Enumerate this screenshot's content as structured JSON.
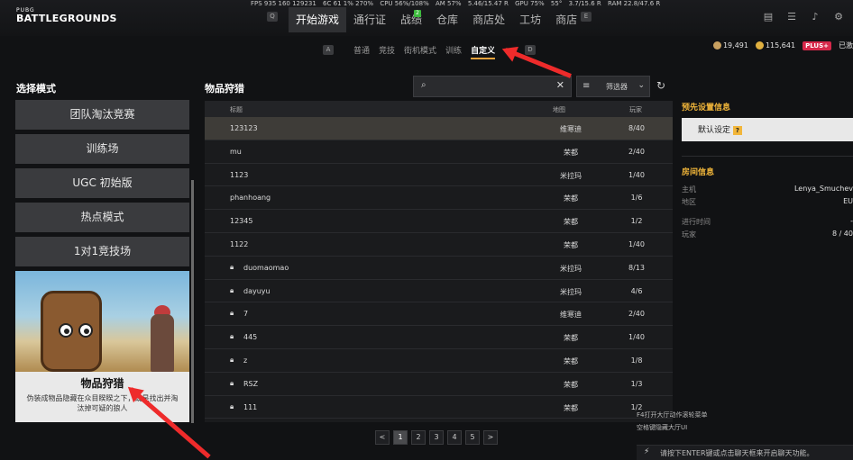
{
  "perf": [
    "FPS 935 160 129231",
    "6C 61 1% 270%",
    "CPU 56%/108%",
    "AM 57%",
    "5.46/15.47 R",
    "GPU 75%",
    "55°",
    "3.7/15.6 R",
    "RAM 22.8/47.6 R"
  ],
  "logo": {
    "small": "PUBG",
    "big": "BATTLEGROUNDS"
  },
  "keyhints": {
    "q": "Q",
    "e": "E",
    "a": "A",
    "d": "D"
  },
  "nav": {
    "tabs": [
      "开始游戏",
      "通行证",
      "战绩",
      "仓库",
      "商店处",
      "工坊",
      "商店"
    ],
    "badge": "2"
  },
  "top_icons": [
    "inbox-icon",
    "friends-icon",
    "bell-icon",
    "settings-icon"
  ],
  "subtabs": [
    "普通",
    "竞技",
    "街机模式",
    "训练",
    "自定义"
  ],
  "currency": {
    "bp": "19,491",
    "gcoin": "115,641",
    "plus": "PLUS+",
    "plus_tail": "已激"
  },
  "left": {
    "title": "选择模式",
    "modes": [
      "团队淘汰竞赛",
      "训练场",
      "UGC 初始版",
      "热点模式",
      "1对1竞技场"
    ],
    "card_title": "物品狩猎",
    "card_desc": "伪装成物品隐藏在众目睽睽之下，或是找出并淘汰掉可疑的狼人"
  },
  "middle": {
    "title": "物品狩猎",
    "search_placeholder": "",
    "filter_label": "筛选器",
    "columns": {
      "name": "标题",
      "map": "地图",
      "players": "玩家"
    },
    "rows": [
      {
        "name": "123123",
        "map": "维寒迪",
        "players": "8/40",
        "locked": false
      },
      {
        "name": "mu",
        "map": "荣都",
        "players": "2/40",
        "locked": false
      },
      {
        "name": "1123",
        "map": "米拉玛",
        "players": "1/40",
        "locked": false
      },
      {
        "name": "phanhoang",
        "map": "荣都",
        "players": "1/6",
        "locked": false
      },
      {
        "name": "12345",
        "map": "荣都",
        "players": "1/2",
        "locked": false
      },
      {
        "name": "1122",
        "map": "荣都",
        "players": "1/40",
        "locked": false
      },
      {
        "name": "duomaomao",
        "map": "米拉玛",
        "players": "8/13",
        "locked": true
      },
      {
        "name": "dayuyu",
        "map": "米拉玛",
        "players": "4/6",
        "locked": true
      },
      {
        "name": "7",
        "map": "维寒迪",
        "players": "2/40",
        "locked": true
      },
      {
        "name": "445",
        "map": "荣都",
        "players": "1/40",
        "locked": true
      },
      {
        "name": "z",
        "map": "荣都",
        "players": "1/8",
        "locked": true
      },
      {
        "name": "RSZ",
        "map": "荣都",
        "players": "1/3",
        "locked": true
      },
      {
        "name": "111",
        "map": "荣都",
        "players": "1/2",
        "locked": true
      }
    ],
    "pages": [
      "1",
      "2",
      "3",
      "4",
      "5"
    ],
    "prev": "<",
    "next": ">"
  },
  "right": {
    "preset_title": "预先设置信息",
    "preset_value": "默认设定",
    "help": "?",
    "room_title": "房间信息",
    "host_label": "主机",
    "host_value": "Lenya_Smuchev",
    "region_label": "地区",
    "region_value": "EU",
    "time_label": "进行时间",
    "time_value": "-",
    "players_label": "玩家",
    "players_value": "8 / 40"
  },
  "chat": {
    "line1": "F4打开大厅动作滚轮菜单",
    "line2": "空格键隐藏大厅UI",
    "input_hint": "请按下ENTER键或点击聊天框来开启聊天功能。"
  },
  "colors": {
    "accent": "#f2b63a",
    "arrow": "#ee2b2b",
    "plus": "#d6284a"
  }
}
